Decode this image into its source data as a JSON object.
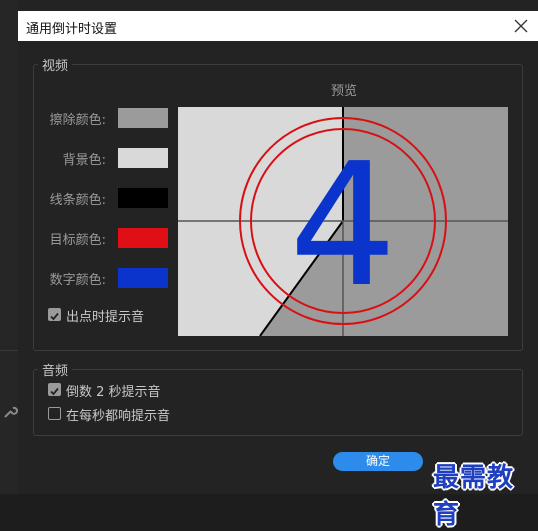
{
  "dialog": {
    "title": "通用倒计时设置"
  },
  "video": {
    "label": "视频",
    "preview_label": "预览",
    "settings": [
      {
        "label": "擦除颜色:",
        "color": "#9b9b9b"
      },
      {
        "label": "背景色:",
        "color": "#d9d9d9"
      },
      {
        "label": "线条颜色:",
        "color": "#000000"
      },
      {
        "label": "目标颜色:",
        "color": "#e00f16"
      },
      {
        "label": "数字颜色:",
        "color": "#0a34cc"
      }
    ],
    "cue_at_out": {
      "label": "出点时提示音",
      "checked": true
    },
    "preview_number": "4"
  },
  "audio": {
    "label": "音频",
    "beep_2s": {
      "label": "倒数 2 秒提示音",
      "checked": true
    },
    "beep_each_second": {
      "label": "在每秒都响提示音",
      "checked": false
    }
  },
  "buttons": {
    "ok_label": "确定"
  },
  "watermark": "最需教育"
}
